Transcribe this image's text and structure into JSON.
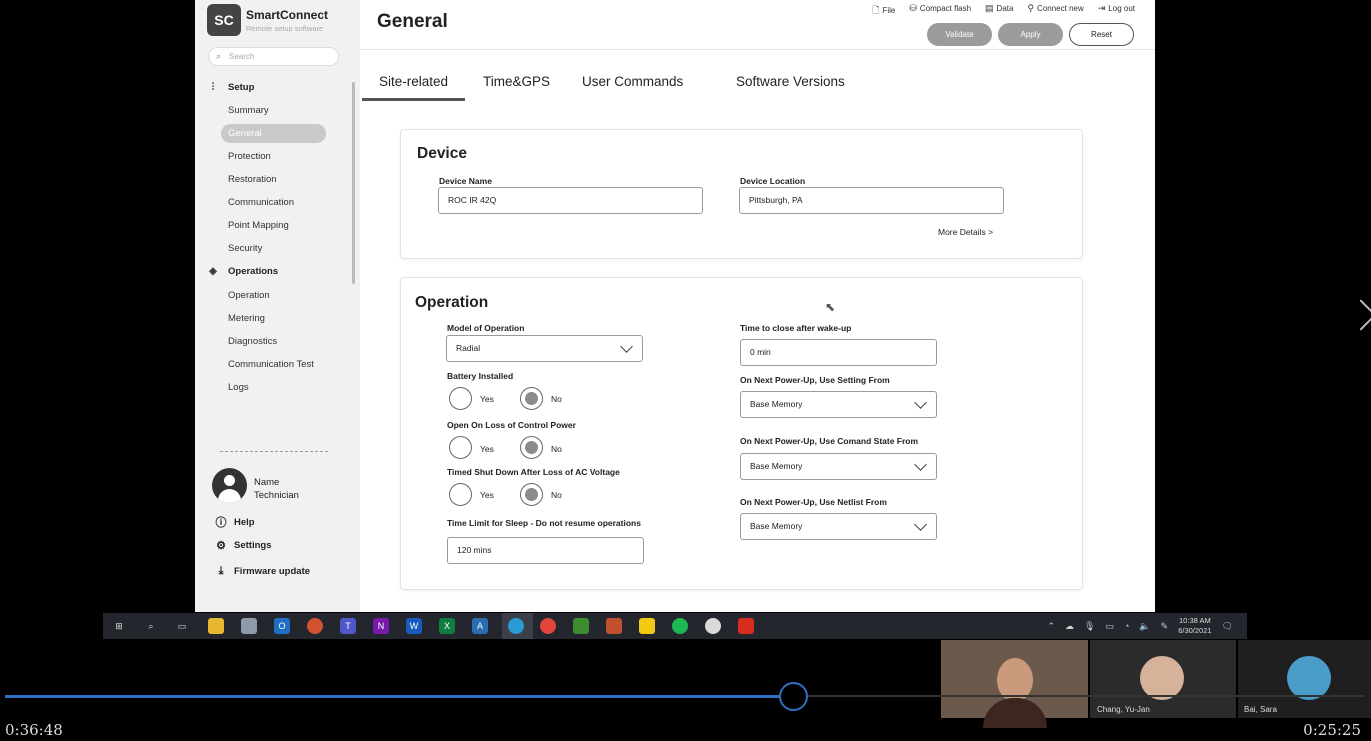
{
  "app": {
    "brand": "SmartConnect",
    "tagline": "Remote setup software",
    "search_placeholder": "Search",
    "page_title": "General"
  },
  "top_links": {
    "file": "File",
    "compact_flash": "Compact flash",
    "data": "Data",
    "connect_new": "Connect new",
    "log_out": "Log out"
  },
  "actions": {
    "validate": "Validate",
    "apply": "Apply",
    "reset": "Reset"
  },
  "sidebar": {
    "setup_title": "Setup",
    "setup_items": [
      "Summary",
      "General",
      "Protection",
      "Restoration",
      "Communication",
      "Point Mapping",
      "Security"
    ],
    "operations_title": "Operations",
    "operations_items": [
      "Operation",
      "Metering",
      "Diagnostics",
      "Communication Test",
      "Logs"
    ],
    "user": {
      "name": "Name",
      "role": "Technician"
    },
    "footer": {
      "help": "Help",
      "settings": "Settings",
      "firmware": "Firmware update"
    }
  },
  "tabs": [
    "Site-related",
    "Time&GPS",
    "User Commands",
    "Software Versions"
  ],
  "device": {
    "title": "Device",
    "name_label": "Device Name",
    "name_value": "ROC IR 42Q",
    "location_label": "Device Location",
    "location_value": "Pittsburgh, PA",
    "more_details": "More Details >"
  },
  "operation": {
    "title": "Operation",
    "model_label": "Model of Operation",
    "model_value": "Radial",
    "battery_label": "Battery Installed",
    "open_loss_label": "Open On Loss of Control Power",
    "timed_shutdown_label": "Timed Shut Down After Loss of AC Voltage",
    "yes": "Yes",
    "no": "No",
    "sleep_label": "Time Limit for Sleep - Do not resume operations",
    "sleep_value": "120 mins",
    "wake_label": "Time to close after wake-up",
    "wake_value": "0 min",
    "setting_from_label": "On Next Power-Up, Use Setting From",
    "setting_from_value": "Base Memory",
    "command_state_label": "On Next Power-Up, Use Comand State From",
    "command_state_value": "Base Memory",
    "netlist_label": "On Next Power-Up, Use Netlist From",
    "netlist_value": "Base Memory"
  },
  "taskbar": {
    "time": "10:38 AM",
    "date": "6/30/2021"
  },
  "video": {
    "elapsed": "0:36:48",
    "remaining": "0:25:25",
    "progress": 0.58,
    "participants": [
      "Chang, Yu-Jan",
      "Bai, Sara"
    ]
  }
}
